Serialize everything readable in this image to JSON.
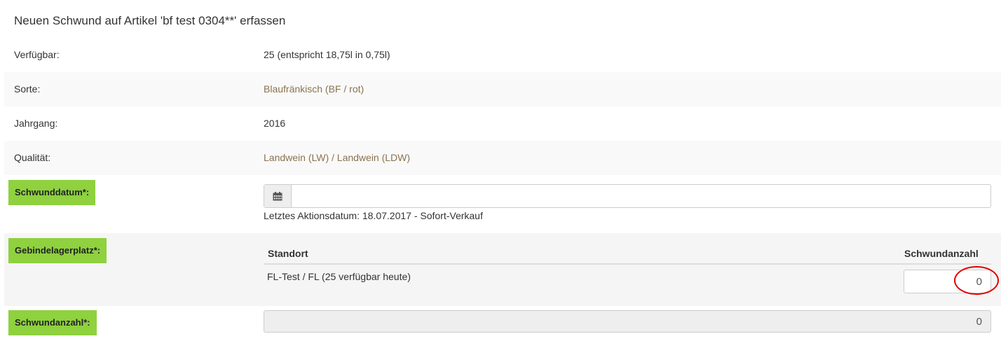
{
  "title": "Neuen Schwund auf Artikel 'bf test 0304**' erfassen",
  "info": {
    "verfuegbar": {
      "label": "Verfügbar:",
      "value": "25 (entspricht 18,75l in 0,75l)"
    },
    "sorte": {
      "label": "Sorte:",
      "value": "Blaufränkisch (BF / rot)"
    },
    "jahrgang": {
      "label": "Jahrgang:",
      "value": "2016"
    },
    "qualitaet": {
      "label": "Qualität:",
      "value": "Landwein (LW) / Landwein (LDW)"
    }
  },
  "schwunddatum": {
    "label": "Schwunddatum*:",
    "value": "",
    "icon": "calendar-icon",
    "hint": "Letztes Aktionsdatum: 18.07.2017 - Sofort-Verkauf"
  },
  "gebindelagerplatz": {
    "label": "Gebindelagerplatz*:",
    "columns": [
      "Standort",
      "Schwundanzahl"
    ],
    "rows": [
      {
        "standort": "FL-Test / FL (25 verfügbar heute)",
        "schwundanzahl": "0"
      }
    ]
  },
  "schwundanzahl": {
    "label": "Schwundanzahl*:",
    "value": "0"
  },
  "colors": {
    "label_green": "#8fd13f",
    "link": "#8a7350",
    "highlight_circle": "#e00000"
  }
}
